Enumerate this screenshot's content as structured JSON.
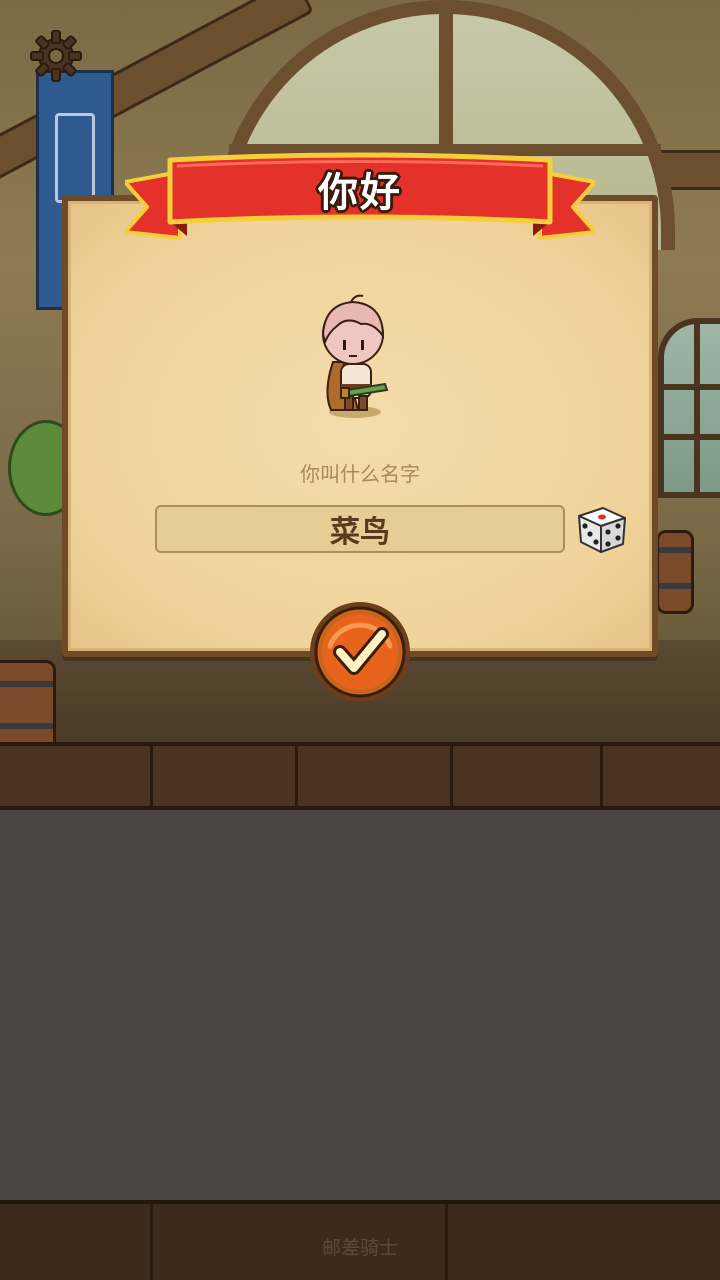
{
  "dialog": {
    "title": "你好",
    "prompt": "你叫什么名字",
    "name_value": "菜鸟"
  },
  "footer": {
    "label": "邮差骑士"
  },
  "icons": {
    "settings": "gear-icon",
    "randomize": "dice-icon",
    "confirm": "checkmark-icon"
  },
  "colors": {
    "ribbon_red": "#e4322b",
    "confirm_orange": "#e8641c",
    "parchment": "#f0d39b",
    "board_gray": "#4a4542"
  }
}
